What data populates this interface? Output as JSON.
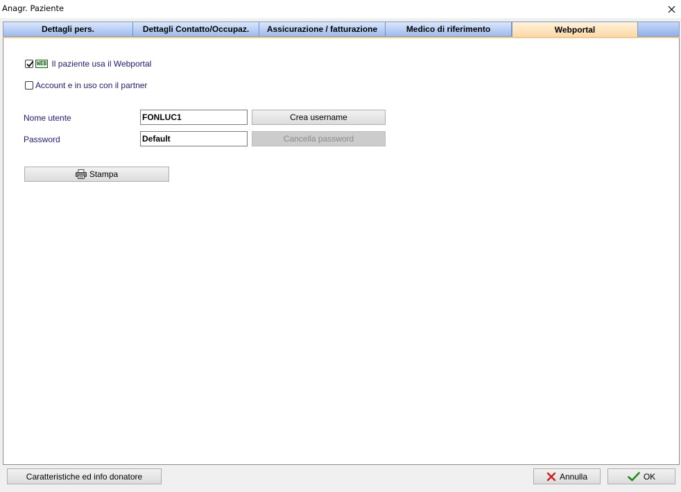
{
  "window": {
    "title": "Anagr. Paziente",
    "close_icon": "close-icon"
  },
  "tabs": [
    {
      "label": "Dettagli pers.",
      "active": false
    },
    {
      "label": "Dettagli Contatto/Occupaz.",
      "active": false
    },
    {
      "label": "Assicurazione / fatturazione",
      "active": false
    },
    {
      "label": "Medico di riferimento",
      "active": false
    },
    {
      "label": "Webportal",
      "active": true
    }
  ],
  "webportal": {
    "uses_webportal": {
      "label": "Il paziente usa il Webportal",
      "checked": true,
      "badge": "WEB"
    },
    "account_partner": {
      "label": "Account e in uso con il partner",
      "checked": false
    },
    "username": {
      "label": "Nome utente",
      "value": "FONLUC1",
      "button": "Crea username"
    },
    "password": {
      "label": "Password",
      "value": "Default",
      "button": "Cancella password",
      "button_disabled": true
    },
    "print_button": {
      "label": "Stampa",
      "icon": "printer-icon"
    }
  },
  "footer": {
    "donor_button": "Caratteristiche ed info donatore",
    "cancel_button": {
      "label": "Annulla",
      "icon": "x-icon",
      "color": "#d11a1a"
    },
    "ok_button": {
      "label": "OK",
      "icon": "check-icon",
      "color": "#1e8a1e"
    }
  }
}
